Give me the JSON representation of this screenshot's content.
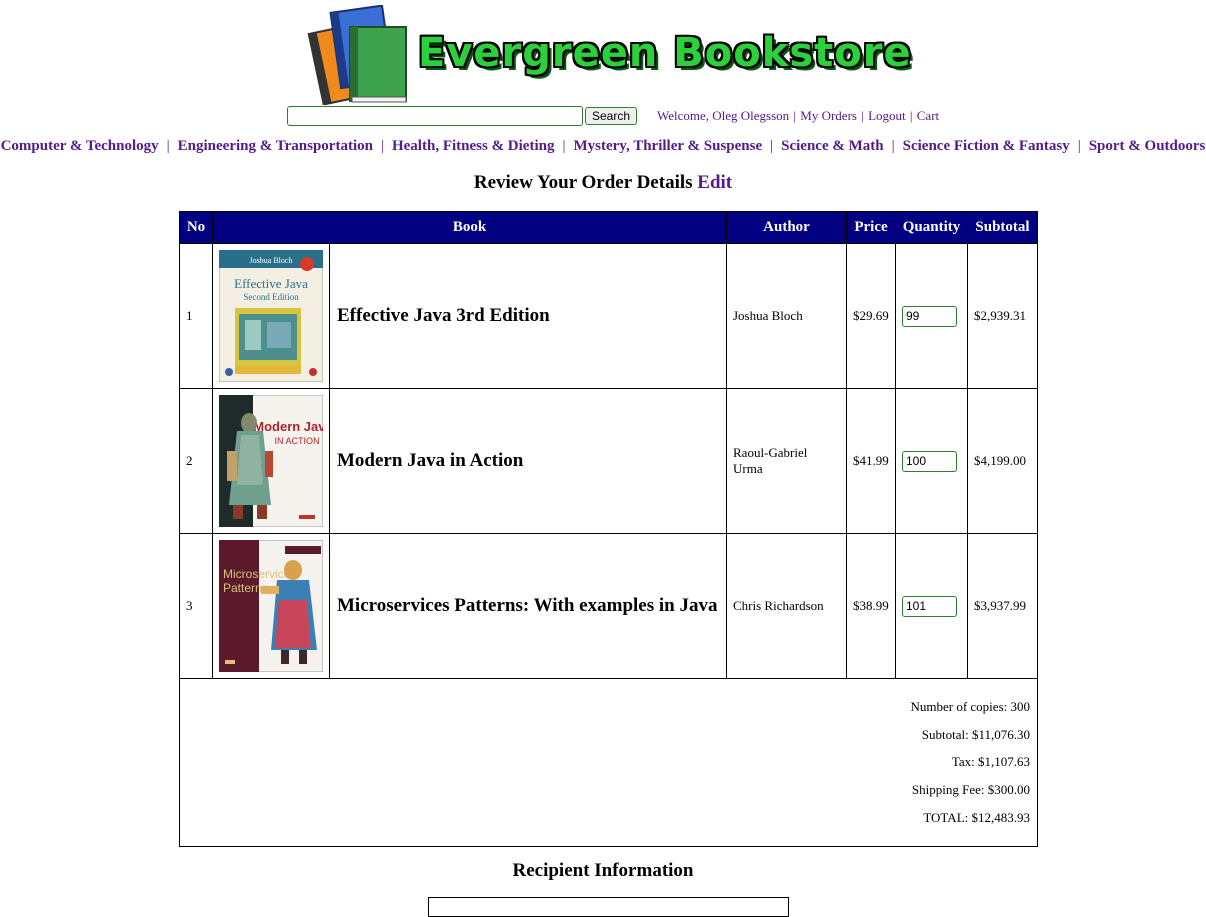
{
  "header": {
    "logo_text": "Evergreen Bookstore",
    "search": {
      "value": "",
      "button_label": "Search"
    },
    "user_links": {
      "welcome": "Welcome, Oleg Olegsson",
      "sep": "|",
      "my_orders": "My Orders",
      "logout": "Logout",
      "cart": "Cart"
    }
  },
  "categories": {
    "sep": "|",
    "items": [
      "Computer & Technology",
      "Engineering & Transportation",
      "Health, Fitness & Dieting",
      "Mystery, Thriller & Suspense",
      "Science & Math",
      "Science Fiction & Fantasy",
      "Sport & Outdoors"
    ]
  },
  "review": {
    "title": "Review Your Order Details",
    "edit_label": "Edit"
  },
  "table": {
    "headers": [
      "No",
      "Book",
      "Author",
      "Price",
      "Quantity",
      "Subtotal"
    ],
    "rows": [
      {
        "no": "1",
        "title": "Effective Java 3rd Edition",
        "author": "Joshua Bloch",
        "price": "$29.69",
        "quantity": "99",
        "subtotal": "$2,939.31",
        "cover": {
          "top_text": "Joshua Bloch",
          "title_text": "Effective Java",
          "sub_text": "Second Edition",
          "bg": "#f3efe3",
          "accent": "#2a6f8a"
        }
      },
      {
        "no": "2",
        "title": "Modern Java in Action",
        "author": "Raoul-Gabriel Urma",
        "price": "$41.99",
        "quantity": "100",
        "subtotal": "$4,199.00",
        "cover": {
          "top_text": "",
          "title_text": "Modern Java",
          "sub_text": "IN ACTION",
          "bg": "#f6f3ee",
          "accent": "#b0232a"
        }
      },
      {
        "no": "3",
        "title": "Microservices Patterns: With examples in Java",
        "author": "Chris Richardson",
        "price": "$38.99",
        "quantity": "101",
        "subtotal": "$3,937.99",
        "cover": {
          "top_text": "",
          "title_text": "Microservices",
          "sub_text": "Patterns",
          "bg": "#5a1a2b",
          "accent": "#d9c27a"
        }
      }
    ],
    "summary": {
      "copies": "Number of copies: 300",
      "subtotal": "Subtotal: $11,076.30",
      "tax": "Tax: $1,107.63",
      "shipping": "Shipping Fee: $300.00",
      "total": "TOTAL: $12,483.93"
    }
  },
  "recipient": {
    "title": "Recipient Information"
  },
  "colors": {
    "table_header": "#000080",
    "link": "#551a8b",
    "logo_green": "#2bd13a",
    "input_border": "#2e7d32"
  }
}
